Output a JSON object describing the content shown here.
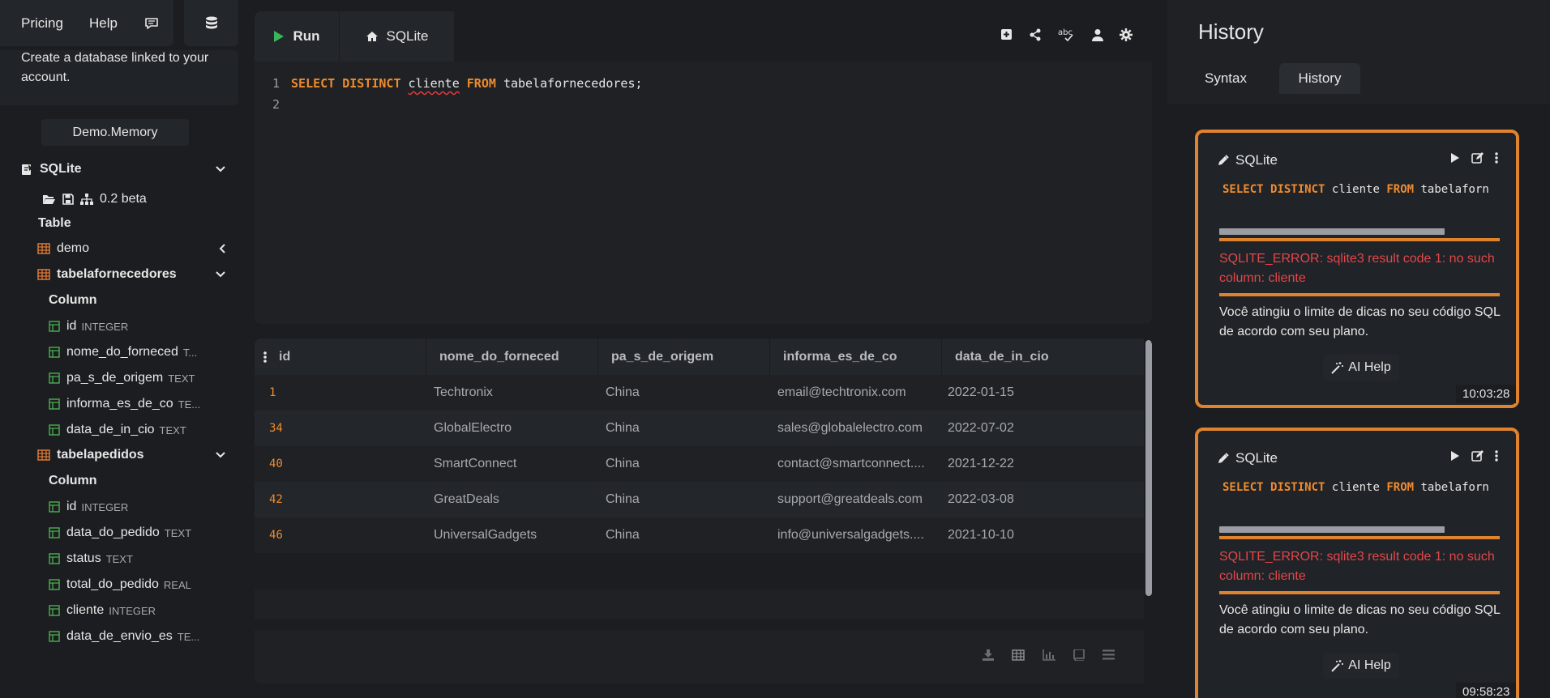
{
  "colors": {
    "accent": "#e0832e",
    "keyword": "#f08b2e",
    "error": "#e2474b",
    "run_green": "#3bb55a",
    "table_icon": "#e07a35",
    "column_icon": "#4caf50"
  },
  "topnav": {
    "pricing": "Pricing",
    "help": "Help",
    "chat_icon": "chat-bubble-icon",
    "db_icon": "database-icon"
  },
  "notice": {
    "text": "Create a database linked to your account."
  },
  "demo_memory": "Demo.Memory",
  "db": {
    "name": "SQLite",
    "version": "0.2 beta",
    "table_header": "Table",
    "column_header": "Column",
    "tables": [
      {
        "name": "demo"
      },
      {
        "name": "tabelafornecedores",
        "columns": [
          {
            "name": "id",
            "type": "INTEGER"
          },
          {
            "name": "nome_do_forneced",
            "type": "T..."
          },
          {
            "name": "pa_s_de_origem",
            "type": "TEXT"
          },
          {
            "name": "informa_es_de_co",
            "type": "TE..."
          },
          {
            "name": "data_de_in_cio",
            "type": "TEXT"
          }
        ]
      },
      {
        "name": "tabelapedidos",
        "columns": [
          {
            "name": "id",
            "type": "INTEGER"
          },
          {
            "name": "data_do_pedido",
            "type": "TEXT"
          },
          {
            "name": "status",
            "type": "TEXT"
          },
          {
            "name": "total_do_pedido",
            "type": "REAL"
          },
          {
            "name": "cliente",
            "type": "INTEGER"
          },
          {
            "name": "data_de_envio_es",
            "type": "TE..."
          }
        ]
      }
    ]
  },
  "editor": {
    "run_label": "Run",
    "tab_label": "SQLite",
    "tool_icons": [
      "plus-square-icon",
      "share-icon",
      "spellcheck-icon",
      "user-icon",
      "gear-icon"
    ],
    "line_numbers": [
      "1",
      "2"
    ],
    "code": {
      "kw_select": "SELECT",
      "kw_distinct": "DISTINCT",
      "ident": "cliente",
      "kw_from": "FROM",
      "rest": "tabelafornecedores;"
    }
  },
  "results": {
    "columns": [
      "id",
      "nome_do_forneced",
      "pa_s_de_origem",
      "informa_es_de_co",
      "data_de_in_cio"
    ],
    "rows": [
      [
        "1",
        "Techtronix",
        "China",
        "email@techtronix.com",
        "2022-01-15"
      ],
      [
        "34",
        "GlobalElectro",
        "China",
        "sales@globalelectro.com",
        "2022-07-02"
      ],
      [
        "40",
        "SmartConnect",
        "China",
        "contact@smartconnect....",
        "2021-12-22"
      ],
      [
        "42",
        "GreatDeals",
        "China",
        "support@greatdeals.com",
        "2022-03-08"
      ],
      [
        "46",
        "UniversalGadgets",
        "China",
        "info@universalgadgets....",
        "2021-10-10"
      ]
    ],
    "footer_icons": [
      "download-icon",
      "table-view-icon",
      "bar-chart-icon",
      "book-icon",
      "menu-icon"
    ]
  },
  "history": {
    "title": "History",
    "tabs": [
      "Syntax",
      "History"
    ],
    "entries": [
      {
        "engine": "SQLite",
        "sql": {
          "kw1": "SELECT",
          "kw2": "DISTINCT",
          "ident": "cliente",
          "kw3": "FROM",
          "rest": "tabelaforn"
        },
        "error": "SQLITE_ERROR: sqlite3 result code 1: no such column: cliente",
        "message": "Você atingiu o limite de dicas no seu código SQL de acordo com seu plano.",
        "ai_help": "AI Help",
        "time": "10:03:28"
      },
      {
        "engine": "SQLite",
        "sql": {
          "kw1": "SELECT",
          "kw2": "DISTINCT",
          "ident": "cliente",
          "kw3": "FROM",
          "rest": "tabelaforn"
        },
        "error": "SQLITE_ERROR: sqlite3 result code 1: no such column: cliente",
        "message": "Você atingiu o limite de dicas no seu código SQL de acordo com seu plano.",
        "ai_help": "AI Help",
        "time": "09:58:23"
      }
    ]
  }
}
